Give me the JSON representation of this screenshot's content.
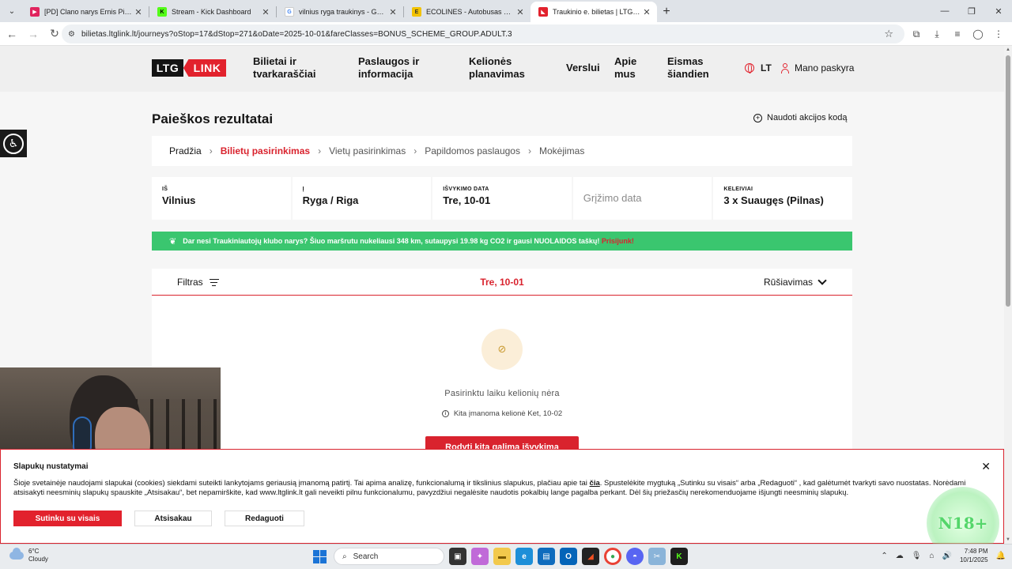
{
  "browser": {
    "tabs": [
      {
        "title": "[PD] Clano narys Ernis Pirmas d",
        "favicon_color": "#e0245e",
        "active": false
      },
      {
        "title": "Stream - Kick Dashboard",
        "favicon_color": "#53fc18",
        "active": false
      },
      {
        "title": "vilnius ryga traukinys - Google",
        "favicon_color": "#4285f4",
        "active": false
      },
      {
        "title": "ECOLINES - Autobusas Vilnius",
        "favicon_color": "#f2c200",
        "active": false
      },
      {
        "title": "Traukinio e. bilietas | LTG Link",
        "favicon_color": "#e2222d",
        "active": true
      }
    ],
    "url": "bilietas.ltglink.lt/journeys?oStop=17&dStop=271&oDate=2025-10-01&fareClasses=BONUS_SCHEME_GROUP.ADULT.3"
  },
  "header": {
    "logo_left": "LTG",
    "logo_right": "LINK",
    "nav": [
      {
        "line1": "Bilietai ir",
        "line2": "tvarkaraščiai"
      },
      {
        "line1": "Paslaugos ir",
        "line2": "informacija"
      },
      {
        "line1": "Kelionės",
        "line2": "planavimas"
      },
      {
        "line1": "Verslui",
        "line2": ""
      },
      {
        "line1": "Apie",
        "line2": "mus"
      },
      {
        "line1": "Eismas",
        "line2": "šiandien"
      }
    ],
    "language": "LT",
    "account": "Mano paskyra"
  },
  "main": {
    "title": "Paieškos rezultatai",
    "promo_code": "Naudoti akcijos kodą",
    "steps": [
      "Pradžia",
      "Bilietų pasirinkimas",
      "Vietų pasirinkimas",
      "Papildomos paslaugos",
      "Mokėjimas"
    ],
    "search": {
      "from_label": "IŠ",
      "from_value": "Vilnius",
      "to_label": "Į",
      "to_value": "Ryga / Riga",
      "depart_label": "IŠVYKIMO DATA",
      "depart_value": "Tre, 10-01",
      "return_placeholder": "Grįžimo data",
      "passengers_label": "KELEIVIAI",
      "passengers_value": "3 x Suaugęs (Pilnas)"
    },
    "club_banner": {
      "text": "Dar nesi Traukiniautojų klubo narys? Šiuo maršrutu nukeliausi 348 km, sutaupysi 19.98 kg CO2 ir gausi NUOLAIDOS taškų!",
      "link": "Prisijunk!"
    },
    "results": {
      "filter": "Filtras",
      "date": "Tre, 10-01",
      "sort": "Rūšiavimas",
      "empty": "Pasirinktu laiku kelionių nėra",
      "other_trip": "Kita įmanoma kelionė Ket, 10-02",
      "button": "Rodyti kitą galimą išvykimą"
    }
  },
  "cookie": {
    "title": "Slapukų nustatymai",
    "text_1": "Šioje svetainėje naudojami slapukai (cookies) siekdami suteikti lankytojams geriausią įmanomą patirtį. Tai apima analizę, funkcionalumą ir tikslinius slapukus, plačiau apie tai",
    "text_link": "čia",
    "text_2": ". Spustelėkite mygtuką „Sutinku su visais“ arba „Redaguoti“ , kad galėtumėt tvarkyti savo nuostatas. Norėdami atsisakyti neesminių slapukų spauskite „Atsisakau“, bet nepamirškite, kad www.ltglink.lt gali neveikti pilnu funkcionalumu, pavyzdžiui negalėsite naudotis pokalbių lange pagalba perkant. Dėl šių priežasčių nerekomenduojame išjungti neesminių slapukų.",
    "accept": "Sutinku su visais",
    "reject": "Atsisakau",
    "edit": "Redaguoti"
  },
  "overlay": {
    "badge": "N18+"
  },
  "taskbar": {
    "temp": "6°C",
    "weather": "Cloudy",
    "search": "Search",
    "time": "7:48 PM",
    "date": "10/1/2025"
  }
}
